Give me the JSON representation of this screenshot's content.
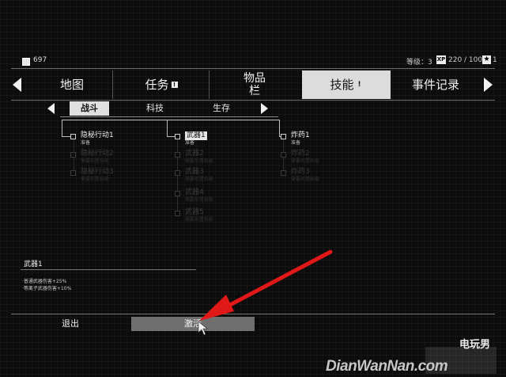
{
  "status": {
    "money": "697",
    "level_label": "等级：3",
    "xp_badge": "XP",
    "xp_value": "220 / 1000",
    "star_badge": "★",
    "star_count": "1"
  },
  "main_tabs": [
    {
      "label": "地图",
      "badge": ""
    },
    {
      "label": "任务",
      "badge": "!"
    },
    {
      "label": "物品栏",
      "badge": ""
    },
    {
      "label": "技能",
      "badge": "!"
    },
    {
      "label": "事件记录",
      "badge": ""
    }
  ],
  "sub_tabs": [
    {
      "label": "战斗"
    },
    {
      "label": "科技"
    },
    {
      "label": "生存"
    }
  ],
  "skills": {
    "col1": [
      {
        "name": "隐秘行动1",
        "sub": "准备"
      },
      {
        "name": "隐秘行动2",
        "sub": "需要前置技能"
      },
      {
        "name": "隐秘行动3",
        "sub": "需要前置技能"
      }
    ],
    "col2": [
      {
        "name": "武器1",
        "sub": "准备"
      },
      {
        "name": "武器2",
        "sub": "需要前置技能"
      },
      {
        "name": "武器3",
        "sub": "需要前置技能"
      },
      {
        "name": "武器4",
        "sub": "需要前置技能"
      },
      {
        "name": "武器5",
        "sub": "需要前置技能"
      }
    ],
    "col3": [
      {
        "name": "炸药1",
        "sub": "准备"
      },
      {
        "name": "炸药2",
        "sub": "需要前置技能"
      },
      {
        "name": "炸药3",
        "sub": "需要前置技能"
      }
    ]
  },
  "description": {
    "title": "武器1",
    "effects": [
      "·普通武器伤害+25%",
      "·等离子武器伤害+10%"
    ]
  },
  "bottom": {
    "exit_label": "退出",
    "activate_label": "激活"
  },
  "watermark": {
    "site": "DianWanNan.com",
    "brand": "电玩男"
  },
  "colors": {
    "background": "#0c0c0c",
    "active_tab": "#dcdcdc",
    "activate_button": "#6f6f6f",
    "annotation_arrow": "#e01818"
  }
}
